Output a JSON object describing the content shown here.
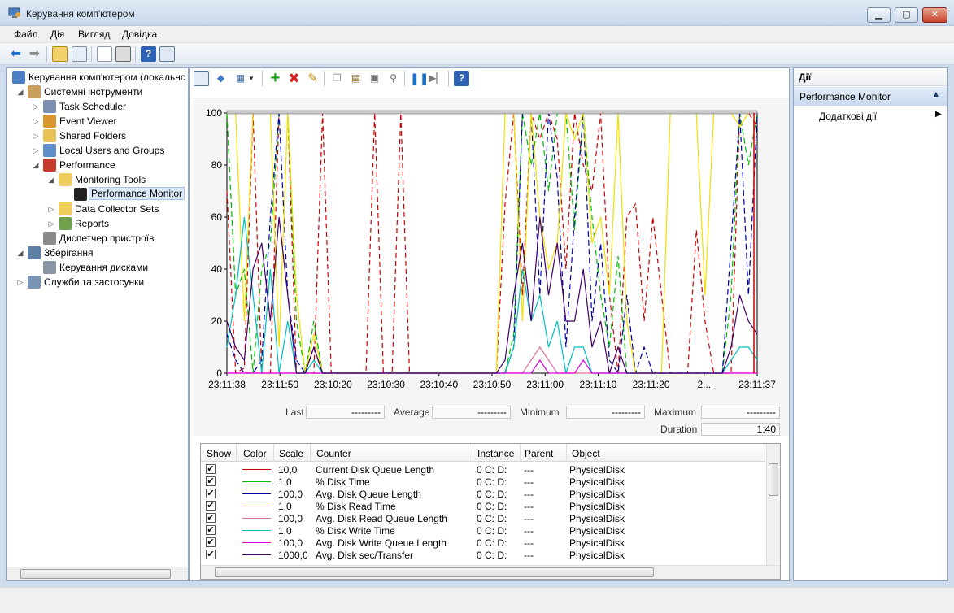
{
  "window": {
    "title": "Керування комп'ютером",
    "minimize": "▁",
    "maximize": "▢",
    "close": "✕"
  },
  "menu": [
    "Файл",
    "Дія",
    "Вигляд",
    "Довідка"
  ],
  "tree": [
    {
      "label": "Керування комп'ютером (локальнс",
      "level": 0,
      "arrow": "",
      "icon": "computer-icon"
    },
    {
      "label": "Системні інструменти",
      "level": 1,
      "arrow": "◢",
      "icon": "tools-icon"
    },
    {
      "label": "Task Scheduler",
      "level": 2,
      "arrow": "▷",
      "icon": "clock-icon"
    },
    {
      "label": "Event Viewer",
      "level": 2,
      "arrow": "▷",
      "icon": "event-viewer-icon"
    },
    {
      "label": "Shared Folders",
      "level": 2,
      "arrow": "▷",
      "icon": "shared-folder-icon"
    },
    {
      "label": "Local Users and Groups",
      "level": 2,
      "arrow": "▷",
      "icon": "users-icon"
    },
    {
      "label": "Performance",
      "level": 2,
      "arrow": "◢",
      "icon": "performance-icon"
    },
    {
      "label": "Monitoring Tools",
      "level": 3,
      "arrow": "◢",
      "icon": "folder-icon"
    },
    {
      "label": "Performance Monitor",
      "level": 4,
      "arrow": "",
      "icon": "perfmon-icon",
      "selected": true
    },
    {
      "label": "Data Collector Sets",
      "level": 3,
      "arrow": "▷",
      "icon": "folder-icon"
    },
    {
      "label": "Reports",
      "level": 3,
      "arrow": "▷",
      "icon": "reports-icon"
    },
    {
      "label": "Диспетчер пристроїв",
      "level": 2,
      "arrow": "",
      "icon": "device-manager-icon"
    },
    {
      "label": "Зберігання",
      "level": 1,
      "arrow": "◢",
      "icon": "storage-icon"
    },
    {
      "label": "Керування дисками",
      "level": 2,
      "arrow": "",
      "icon": "disk-icon"
    },
    {
      "label": "Служби та застосунки",
      "level": 1,
      "arrow": "▷",
      "icon": "services-icon"
    }
  ],
  "chart_data": {
    "type": "line",
    "ylim": [
      0,
      100
    ],
    "yticks": [
      "100",
      "80",
      "60",
      "40",
      "20",
      "0"
    ],
    "xticks": [
      "23:11:38",
      "23:11:50",
      "23:10:20",
      "23:10:30",
      "23:10:40",
      "23:10:50",
      "23:11:00",
      "23:11:10",
      "23:11:20",
      "2...",
      "23:11:37"
    ],
    "series": [
      {
        "name": "Current Disk Queue Length",
        "color": "#cc0000",
        "dash": "6,4",
        "values": [
          70,
          0,
          2,
          100,
          0,
          0,
          100,
          100,
          0,
          0,
          0,
          100,
          0,
          0,
          0,
          0,
          0,
          100,
          0,
          0,
          100,
          0,
          0,
          0,
          0,
          0,
          0,
          0,
          0,
          0,
          0,
          0,
          65,
          100,
          30,
          100,
          90,
          100,
          90,
          40,
          100,
          80,
          70,
          100,
          30,
          0,
          60,
          65,
          20,
          60,
          30,
          0,
          0,
          0,
          55,
          20,
          0,
          0,
          0,
          100,
          100,
          95
        ]
      },
      {
        "name": "% Disk Time",
        "color": "#00bb00",
        "dash": "7,4",
        "values": [
          100,
          30,
          40,
          0,
          40,
          50,
          100,
          100,
          20,
          0,
          20,
          0,
          0,
          0,
          0,
          0,
          0,
          0,
          0,
          0,
          0,
          0,
          0,
          0,
          0,
          0,
          0,
          0,
          0,
          0,
          0,
          0,
          0,
          15,
          100,
          80,
          100,
          70,
          100,
          100,
          55,
          100,
          60,
          30,
          10,
          45,
          0,
          0,
          0,
          0,
          0,
          0,
          0,
          0,
          0,
          0,
          0,
          0,
          30,
          100,
          80,
          100
        ]
      },
      {
        "name": "Avg. Disk Queue Length",
        "color": "#0000aa",
        "dash": "7,4",
        "values": [
          15,
          5,
          0,
          0,
          5,
          60,
          100,
          30,
          5,
          0,
          10,
          0,
          0,
          0,
          0,
          0,
          0,
          0,
          0,
          0,
          0,
          0,
          0,
          0,
          0,
          0,
          0,
          0,
          0,
          0,
          0,
          0,
          0,
          10,
          100,
          100,
          30,
          100,
          75,
          10,
          60,
          100,
          20,
          50,
          5,
          0,
          30,
          0,
          10,
          0,
          0,
          0,
          0,
          0,
          0,
          0,
          0,
          0,
          50,
          100,
          30,
          100
        ]
      },
      {
        "name": "% Disk Read Time",
        "color": "#f0e000",
        "dash": "",
        "values": [
          100,
          100,
          20,
          100,
          100,
          100,
          10,
          100,
          30,
          0,
          15,
          0,
          0,
          0,
          0,
          0,
          0,
          0,
          0,
          0,
          0,
          0,
          0,
          0,
          0,
          0,
          0,
          0,
          0,
          0,
          0,
          0,
          100,
          100,
          20,
          100,
          60,
          40,
          50,
          100,
          90,
          100,
          50,
          60,
          30,
          100,
          20,
          0,
          0,
          0,
          0,
          100,
          100,
          100,
          100,
          30,
          100,
          100,
          100,
          95,
          100,
          100
        ]
      },
      {
        "name": "Avg. Disk Read Queue Length",
        "color": "#e070a0",
        "dash": "",
        "values": [
          0,
          0,
          0,
          0,
          0,
          0,
          0,
          0,
          0,
          0,
          0,
          0,
          0,
          0,
          0,
          0,
          0,
          0,
          0,
          0,
          0,
          0,
          0,
          0,
          0,
          0,
          0,
          0,
          0,
          0,
          0,
          0,
          0,
          0,
          0,
          5,
          10,
          5,
          0,
          0,
          0,
          0,
          0,
          0,
          0,
          0,
          0,
          0,
          0,
          0,
          0,
          0,
          0,
          0,
          0,
          0,
          0,
          0,
          0,
          0,
          0,
          0
        ]
      },
      {
        "name": "% Disk Write Time",
        "color": "#00c0c0",
        "dash": "",
        "values": [
          10,
          30,
          60,
          30,
          0,
          40,
          0,
          20,
          0,
          0,
          5,
          0,
          0,
          0,
          0,
          0,
          0,
          0,
          0,
          0,
          0,
          0,
          0,
          0,
          0,
          0,
          0,
          0,
          0,
          0,
          0,
          0,
          0,
          10,
          40,
          20,
          30,
          10,
          20,
          0,
          10,
          10,
          0,
          0,
          0,
          0,
          0,
          0,
          0,
          0,
          0,
          0,
          0,
          0,
          0,
          0,
          0,
          0,
          5,
          10,
          10,
          5
        ]
      },
      {
        "name": "Avg. Disk Write Queue Length",
        "color": "#dd00dd",
        "dash": "",
        "values": [
          0,
          0,
          0,
          0,
          0,
          0,
          0,
          0,
          0,
          0,
          0,
          0,
          0,
          0,
          0,
          0,
          0,
          0,
          0,
          0,
          0,
          0,
          0,
          0,
          0,
          0,
          0,
          0,
          0,
          0,
          0,
          0,
          0,
          0,
          0,
          0,
          5,
          0,
          0,
          0,
          0,
          5,
          0,
          0,
          0,
          0,
          0,
          0,
          0,
          0,
          0,
          0,
          0,
          0,
          0,
          0,
          0,
          0,
          0,
          0,
          0,
          0
        ]
      },
      {
        "name": "Avg. Disk sec/Transfer",
        "color": "#440066",
        "dash": "",
        "values": [
          20,
          10,
          5,
          40,
          50,
          20,
          60,
          30,
          0,
          0,
          10,
          0,
          0,
          0,
          0,
          0,
          0,
          0,
          0,
          0,
          0,
          0,
          0,
          0,
          0,
          0,
          0,
          0,
          0,
          0,
          0,
          0,
          5,
          30,
          50,
          20,
          60,
          30,
          50,
          20,
          20,
          40,
          10,
          20,
          0,
          10,
          0,
          0,
          0,
          0,
          0,
          0,
          0,
          0,
          0,
          0,
          0,
          0,
          10,
          30,
          20,
          15
        ]
      }
    ]
  },
  "stats": {
    "last_label": "Last",
    "last_value": "---------",
    "average_label": "Average",
    "average_value": "---------",
    "minimum_label": "Minimum",
    "minimum_value": "---------",
    "maximum_label": "Maximum",
    "maximum_value": "---------",
    "duration_label": "Duration",
    "duration_value": "1:40"
  },
  "counter_table": {
    "headers": [
      "Show",
      "Color",
      "Scale",
      "Counter",
      "Instance",
      "Parent",
      "Object"
    ],
    "rows": [
      {
        "show": "✔",
        "color": "#cc0000",
        "scale": "10,0",
        "counter": "Current Disk Queue Length",
        "instance": "0 C: D:",
        "parent": "---",
        "object": "PhysicalDisk"
      },
      {
        "show": "✔",
        "color": "#00bb00",
        "scale": "1,0",
        "counter": "% Disk Time",
        "instance": "0 C: D:",
        "parent": "---",
        "object": "PhysicalDisk"
      },
      {
        "show": "✔",
        "color": "#0000aa",
        "scale": "100,0",
        "counter": "Avg. Disk Queue Length",
        "instance": "0 C: D:",
        "parent": "---",
        "object": "PhysicalDisk"
      },
      {
        "show": "✔",
        "color": "#f0e000",
        "scale": "1,0",
        "counter": "% Disk Read Time",
        "instance": "0 C: D:",
        "parent": "---",
        "object": "PhysicalDisk"
      },
      {
        "show": "✔",
        "color": "#e070a0",
        "scale": "100,0",
        "counter": "Avg. Disk Read Queue Length",
        "instance": "0 C: D:",
        "parent": "---",
        "object": "PhysicalDisk"
      },
      {
        "show": "✔",
        "color": "#00c0c0",
        "scale": "1,0",
        "counter": "% Disk Write Time",
        "instance": "0 C: D:",
        "parent": "---",
        "object": "PhysicalDisk"
      },
      {
        "show": "✔",
        "color": "#dd00dd",
        "scale": "100,0",
        "counter": "Avg. Disk Write Queue Length",
        "instance": "0 C: D:",
        "parent": "---",
        "object": "PhysicalDisk"
      },
      {
        "show": "✔",
        "color": "#440066",
        "scale": "1000,0",
        "counter": "Avg. Disk sec/Transfer",
        "instance": "0 C: D:",
        "parent": "---",
        "object": "PhysicalDisk"
      }
    ]
  },
  "actions": {
    "header": "Дії",
    "section": "Performance Monitor",
    "more": "Додаткові дії"
  },
  "colors": {
    "accent": "#1b4f9a",
    "pane_border": "#8fa5c2"
  }
}
